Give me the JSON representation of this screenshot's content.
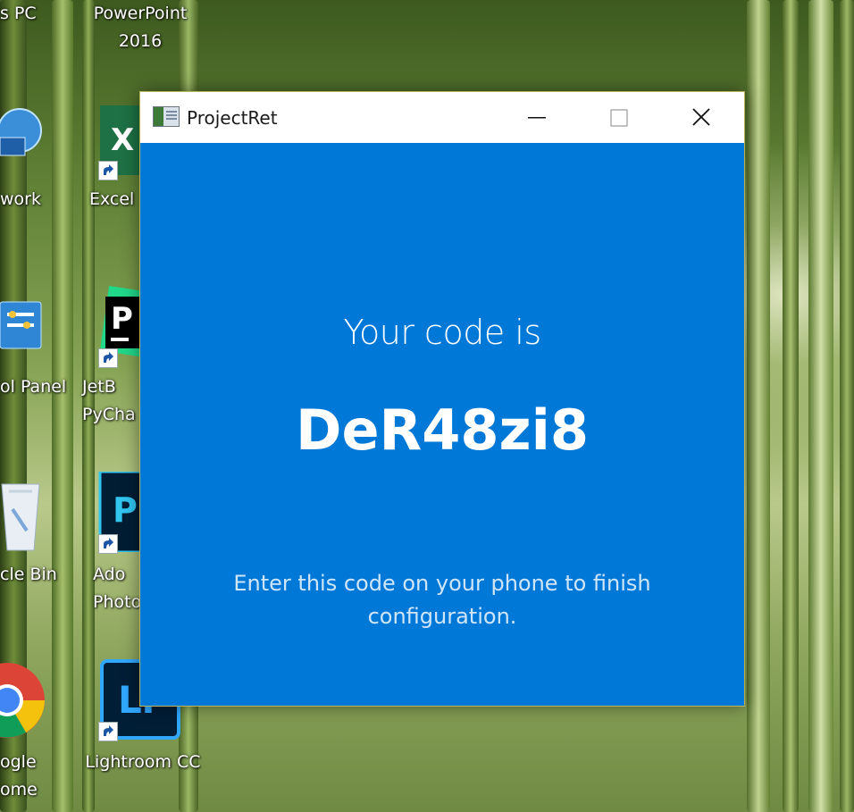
{
  "desktop": {
    "icons": [
      {
        "label": "s PC"
      },
      {
        "label": "PowerPoint\n2016"
      },
      {
        "label": "work"
      },
      {
        "label": "Excel"
      },
      {
        "label": "ol Panel"
      },
      {
        "label": "JetB\nPyCha"
      },
      {
        "label": "cle Bin"
      },
      {
        "label": "Ado\nPhoto"
      },
      {
        "label": "ogle\nome"
      },
      {
        "label": "Lightroom CC"
      }
    ]
  },
  "window": {
    "title": "ProjectRet",
    "app_icon": "app-window-icon",
    "controls": {
      "minimize_icon": "minimize-icon",
      "maximize_icon": "maximize-icon",
      "close_icon": "close-icon"
    },
    "accent_color": "#0078d7",
    "body": {
      "intro": "Your code is",
      "code": "DeR48zi8",
      "instructions": "Enter this code on your phone to finish configuration."
    }
  }
}
